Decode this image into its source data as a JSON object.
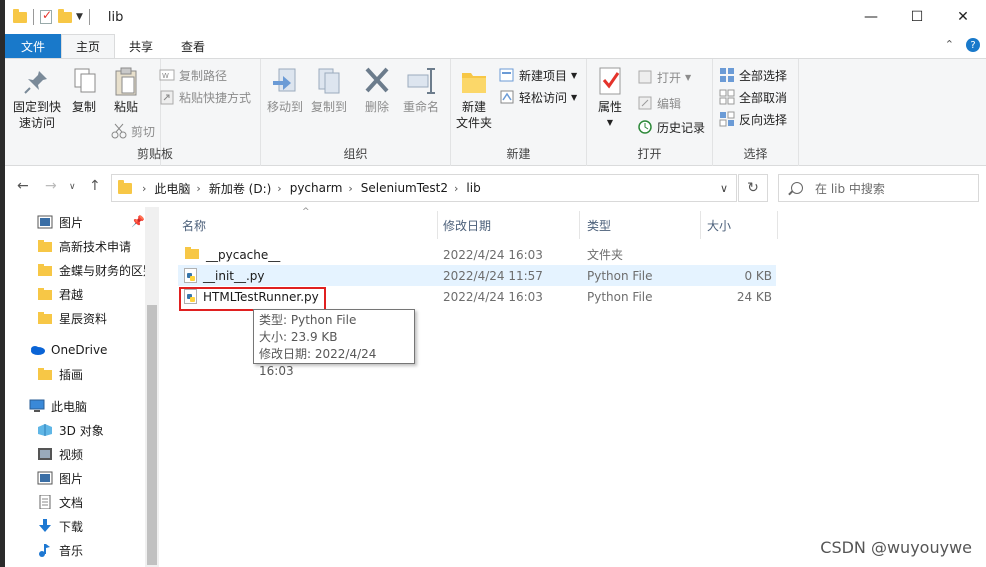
{
  "window": {
    "title": "lib",
    "controls": {
      "minimize": "—",
      "maximize": "☐",
      "close": "✕"
    }
  },
  "tabs": [
    {
      "label": "文件"
    },
    {
      "label": "主页"
    },
    {
      "label": "共享"
    },
    {
      "label": "查看"
    }
  ],
  "ribbon": {
    "clipboard": {
      "label": "剪贴板",
      "pin": "固定到快\n速访问",
      "copy": "复制",
      "paste": "粘贴",
      "copy_path": "复制路径",
      "paste_shortcut": "粘贴快捷方式",
      "cut": "剪切"
    },
    "organize": {
      "label": "组织",
      "move_to": "移动到",
      "copy_to": "复制到",
      "delete": "删除",
      "rename": "重命名"
    },
    "new": {
      "label": "新建",
      "new_folder": "新建\n文件夹",
      "new_item": "新建项目",
      "easy_access": "轻松访问"
    },
    "open": {
      "label": "打开",
      "properties": "属性",
      "open": "打开",
      "edit": "编辑",
      "history": "历史记录"
    },
    "select": {
      "label": "选择",
      "select_all": "全部选择",
      "select_none": "全部取消",
      "invert": "反向选择"
    }
  },
  "address": {
    "crumbs": [
      "此电脑",
      "新加卷 (D:)",
      "pycharm",
      "SeleniumTest2",
      "lib"
    ],
    "search_placeholder": "在 lib 中搜索"
  },
  "nav": {
    "items": [
      {
        "label": "图片",
        "icon": "pictures-icon"
      },
      {
        "label": "高新技术申请",
        "icon": "folder-icon"
      },
      {
        "label": "金蝶与财务的区别",
        "icon": "folder-icon"
      },
      {
        "label": "君越",
        "icon": "folder-icon"
      },
      {
        "label": "星辰资料",
        "icon": "folder-icon"
      },
      {
        "label": "OneDrive",
        "icon": "onedrive-icon"
      },
      {
        "label": "插画",
        "icon": "folder-icon"
      },
      {
        "label": "此电脑",
        "icon": "computer-icon"
      },
      {
        "label": "3D 对象",
        "icon": "3d-objects-icon"
      },
      {
        "label": "视频",
        "icon": "video-icon"
      },
      {
        "label": "图片",
        "icon": "pictures-icon"
      },
      {
        "label": "文档",
        "icon": "documents-icon"
      },
      {
        "label": "下载",
        "icon": "download-icon"
      },
      {
        "label": "音乐",
        "icon": "music-icon"
      }
    ]
  },
  "columns": {
    "name": "名称",
    "date": "修改日期",
    "type": "类型",
    "size": "大小"
  },
  "files": [
    {
      "name": "__pycache__",
      "date": "2022/4/24 16:03",
      "type": "文件夹",
      "size": "",
      "icon": "folder-icon"
    },
    {
      "name": "__init__.py",
      "date": "2022/4/24 11:57",
      "type": "Python File",
      "size": "0 KB",
      "icon": "python-file-icon"
    },
    {
      "name": "HTMLTestRunner.py",
      "date": "2022/4/24 16:03",
      "type": "Python File",
      "size": "24 KB",
      "icon": "python-file-icon"
    }
  ],
  "tooltip": {
    "type": "类型: Python File",
    "size": "大小: 23.9 KB",
    "date": "修改日期: 2022/4/24 16:03"
  },
  "watermark": "CSDN @wuyouywe",
  "colors": {
    "accent": "#1979ca",
    "folder": "#f7c746",
    "highlight": "#e02020",
    "selection": "#e5f3ff"
  }
}
